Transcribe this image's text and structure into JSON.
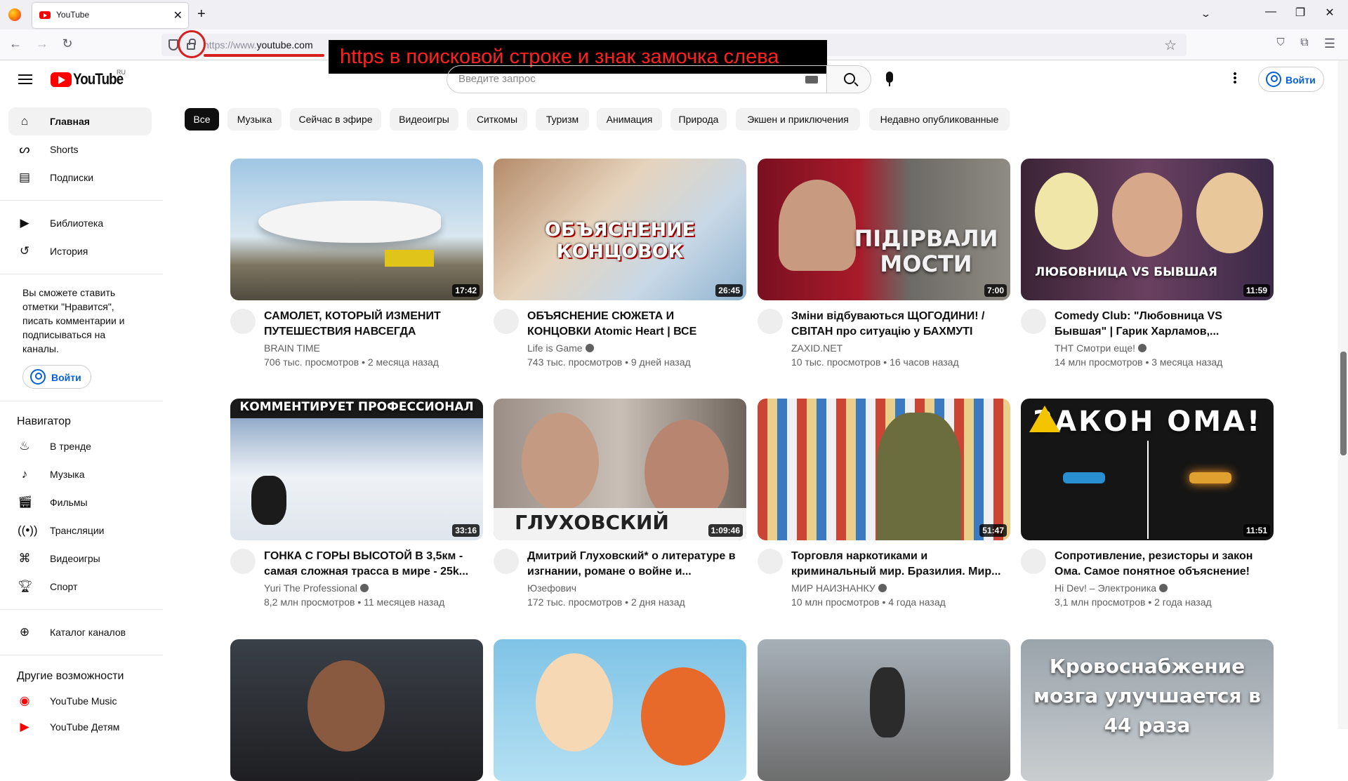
{
  "browser": {
    "tab_title": "YouTube",
    "url_dim": "https://www.",
    "url_main": "youtube.com"
  },
  "annotation": {
    "text": "https в поисковой строке и знак замочка слева",
    "color": "#ff2020"
  },
  "masthead": {
    "logo_text": "YouTube",
    "region": "RU",
    "search_placeholder": "Введите запрос",
    "signin_label": "Войти"
  },
  "sidebar": {
    "main": [
      {
        "label": "Главная",
        "icon": "home-icon"
      },
      {
        "label": "Shorts",
        "icon": "shorts-icon"
      },
      {
        "label": "Подписки",
        "icon": "subscriptions-icon"
      }
    ],
    "library": [
      {
        "label": "Библиотека",
        "icon": "library-icon"
      },
      {
        "label": "История",
        "icon": "history-icon"
      }
    ],
    "signin_text": "Вы сможете ставить отметки \"Нравится\", писать комментарии и подписываться на каналы.",
    "signin_label": "Войти",
    "navigator_heading": "Навигатор",
    "navigator": [
      {
        "label": "В тренде",
        "icon": "trending-icon"
      },
      {
        "label": "Музыка",
        "icon": "music-icon"
      },
      {
        "label": "Фильмы",
        "icon": "movies-icon"
      },
      {
        "label": "Трансляции",
        "icon": "live-icon"
      },
      {
        "label": "Видеоигры",
        "icon": "gaming-icon"
      },
      {
        "label": "Спорт",
        "icon": "sports-icon"
      }
    ],
    "catalog_label": "Каталог каналов",
    "more_heading": "Другие возможности",
    "more": [
      {
        "label": "YouTube Music",
        "icon": "youtube-music-icon"
      },
      {
        "label": "YouTube Детям",
        "icon": "youtube-kids-icon"
      }
    ]
  },
  "chips": [
    "Все",
    "Музыка",
    "Сейчас в эфире",
    "Видеоигры",
    "Ситкомы",
    "Туризм",
    "Анимация",
    "Природа",
    "Экшен и приключения",
    "Недавно опубликованные"
  ],
  "videos": [
    {
      "title": "САМОЛЕТ, КОТОРЫЙ ИЗМЕНИТ ПУТЕШЕСТВИЯ НАВСЕГДА",
      "channel": "BRAIN TIME",
      "meta": "706 тыс. просмотров • 2 месяца назад",
      "duration": "17:42",
      "thumb_text": "",
      "verified": false
    },
    {
      "title": "ОБЪЯСНЕНИЕ СЮЖЕТА И КОНЦОВКИ Atomic Heart | ВСЕ КОНЦОВКИ И...",
      "channel": "Life is Game",
      "meta": "743 тыс. просмотров • 9 дней назад",
      "duration": "26:45",
      "thumb_text": "ОБЪЯСНЕНИЕ КОНЦОВОК",
      "verified": true
    },
    {
      "title": "Зміни відбуваються ЩОГОДИНИ! / СВІТАН про ситуацію у БАХМУТІ",
      "channel": "ZAXID.NET",
      "meta": "10 тыс. просмотров • 16 часов назад",
      "duration": "7:00",
      "thumb_text": "ПІДІРВАЛИ МОСТИ",
      "verified": false
    },
    {
      "title": "Comedy Club: \"Любовница VS Бывшая\" | Гарик Харламов,...",
      "channel": "ТНТ Смотри еще!",
      "meta": "14 млн просмотров • 3 месяца назад",
      "duration": "11:59",
      "thumb_text": "ЛЮБОВНИЦА VS БЫВШАЯ",
      "verified": true
    },
    {
      "title": "ГОНКА С ГОРЫ ВЫСОТОЙ В 3,5км - самая сложная трасса в мире - 25k...",
      "channel": "Yuri The Professional",
      "meta": "8,2 млн просмотров • 11 месяцев назад",
      "duration": "33:16",
      "thumb_text": "КОММЕНТИРУЕТ ПРОФЕССИОНАЛ",
      "verified": true
    },
    {
      "title": "Дмитрий Глуховский* о литературе в изгнании, романе о войне и...",
      "channel": "Юзефович",
      "meta": "172 тыс. просмотров • 2 дня назад",
      "duration": "1:09:46",
      "thumb_text": "ГЛУХОВСКИЙ",
      "verified": false
    },
    {
      "title": "Торговля наркотиками и криминальный мир. Бразилия. Мир...",
      "channel": "МИР НАИЗНАНКУ",
      "meta": "10 млн просмотров • 4 года назад",
      "duration": "51:47",
      "thumb_text": "",
      "verified": true
    },
    {
      "title": "Сопротивление, резисторы и закон Ома. Самое понятное объяснение!",
      "channel": "Hi Dev! – Электроника",
      "meta": "3,1 млн просмотров • 2 года назад",
      "duration": "11:51",
      "thumb_text": "ЗАКОН ОМА!",
      "verified": true
    },
    {
      "title": "",
      "channel": "",
      "meta": "",
      "duration": "",
      "thumb_text": "",
      "verified": false
    },
    {
      "title": "",
      "channel": "",
      "meta": "",
      "duration": "",
      "thumb_text": "",
      "verified": false
    },
    {
      "title": "",
      "channel": "",
      "meta": "",
      "duration": "",
      "thumb_text": "",
      "verified": false
    },
    {
      "title": "",
      "channel": "",
      "meta": "",
      "duration": "",
      "thumb_text": "Кровоснабжение мозга улучшается в 44 раза",
      "verified": false
    }
  ]
}
